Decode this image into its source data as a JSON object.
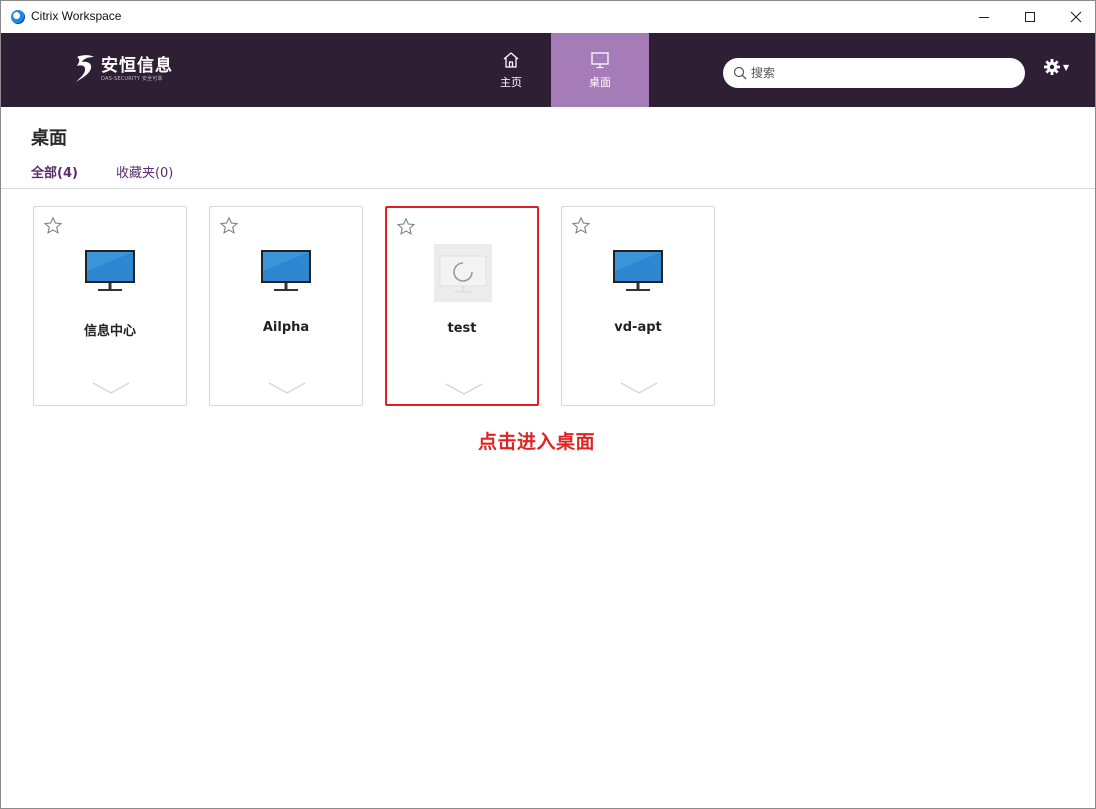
{
  "window": {
    "title": "Citrix Workspace"
  },
  "brand": {
    "logo_text": "安恒信息",
    "logo_sub": "DAS-SECURITY 安全可靠"
  },
  "nav": {
    "tabs": [
      {
        "label": "主页",
        "icon": "home-icon",
        "active": false
      },
      {
        "label": "桌面",
        "icon": "monitor-icon",
        "active": true
      }
    ],
    "active_color": "#a57bb8",
    "background": "#2f1f35"
  },
  "search": {
    "placeholder": "搜索",
    "value": ""
  },
  "page": {
    "title": "桌面",
    "filters": [
      {
        "label": "全部(4)",
        "active": true
      },
      {
        "label": "收藏夹(0)",
        "active": false
      }
    ]
  },
  "desktops": [
    {
      "name": "信息中心",
      "icon": "monitor-icon",
      "selected": false
    },
    {
      "name": "Ailpha",
      "icon": "monitor-icon",
      "selected": false
    },
    {
      "name": "test",
      "icon": "loading-icon",
      "selected": true
    },
    {
      "name": "vd-apt",
      "icon": "monitor-icon",
      "selected": false
    }
  ],
  "annotation": {
    "text": "点击进入桌面",
    "color": "#e02424"
  }
}
